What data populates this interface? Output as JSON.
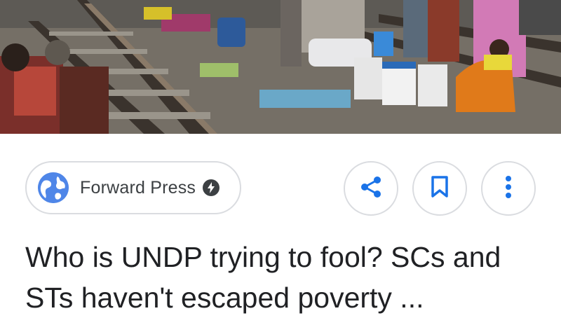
{
  "article": {
    "source_name": "Forward Press",
    "headline": "Who is UNDP trying to fool? SCs and STs haven't escaped poverty ..."
  },
  "icons": {
    "source_logo": "globe-icon",
    "amp": "amp-lightning-icon",
    "share": "share-icon",
    "save": "bookmark-icon",
    "more": "more-vert-icon"
  },
  "colors": {
    "accent": "#1a73e8",
    "chip_border": "#dadce0",
    "text": "#202124"
  }
}
